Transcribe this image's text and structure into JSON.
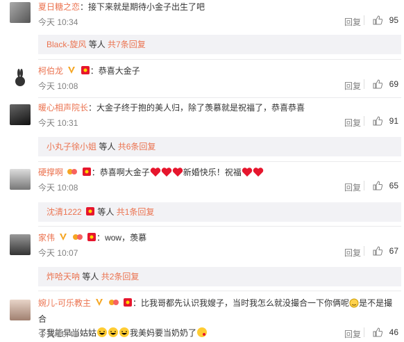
{
  "comments": [
    {
      "username": "夏日糖之恋",
      "text": "接下来就是期待小金子出生了吧",
      "time": "今天 10:34",
      "reply_label": "回复",
      "likes": "95",
      "badges": [],
      "thread": {
        "names": "Black-旋风",
        "mid": "等人",
        "count": "共7条回复"
      }
    },
    {
      "username": "柯伯龙",
      "text": "恭喜大金子",
      "time": "今天 10:08",
      "reply_label": "回复",
      "likes": "69",
      "badges": [
        "v-gold",
        "redpacket"
      ]
    },
    {
      "username": "暖心相声院长",
      "text": "大金子终于抱的美人归，除了羡慕就是祝福了，恭喜恭喜",
      "time": "今天 10:31",
      "reply_label": "回复",
      "likes": "91",
      "badges": [],
      "thread": {
        "names": "小丸子徐小姐",
        "mid": "等人",
        "count": "共6条回复"
      }
    },
    {
      "username": "硬撑啊",
      "text_before": "恭喜啊大金子",
      "text_after": "新婚快乐！祝福",
      "time": "今天 10:08",
      "reply_label": "回复",
      "likes": "65",
      "badges": [
        "fans",
        "redpacket"
      ],
      "thread": {
        "names": "沈清1222",
        "mid": "等人",
        "count": "共1条回复"
      }
    },
    {
      "username": "家伟",
      "text": "wow，羡慕",
      "time": "今天 10:07",
      "reply_label": "回复",
      "likes": "67",
      "badges": [
        "v-gold",
        "fans",
        "redpacket"
      ],
      "thread": {
        "names": "炸哈天呐",
        "mid": "等人",
        "count": "共2条回复"
      }
    },
    {
      "username": "婉儿-可乐教主",
      "text_line1": "比我哥都先认识我嫂子，当时我怎么就没撮合一下你俩呢",
      "text_line1b": "是不是撮合",
      "text_line2a": "了我能早当姑姑",
      "text_line2b": "我美妈要当奶奶了",
      "time": "今天 10:41",
      "reply_label": "回复",
      "likes": "46",
      "badges": [
        "v-gold",
        "fans",
        "redpacket"
      ]
    }
  ],
  "colors": {
    "name": "#eb7350",
    "muted": "#808080",
    "thread_bg": "#f2f2f5"
  }
}
